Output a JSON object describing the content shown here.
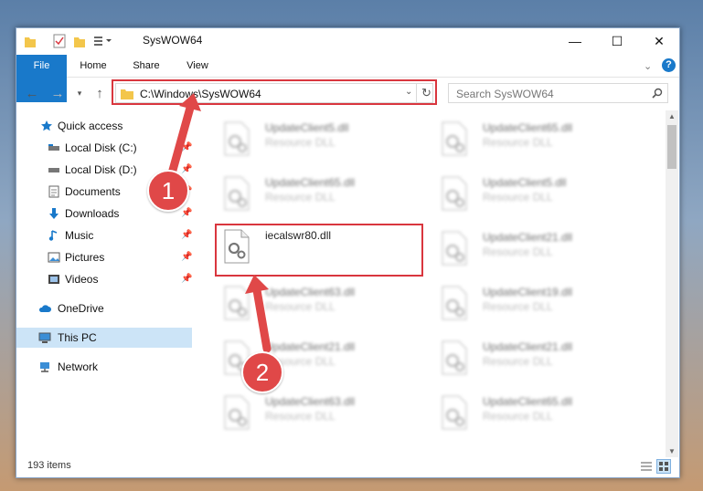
{
  "window": {
    "title": "SysWOW64",
    "controls": {
      "minimize": "—",
      "maximize": "☐",
      "close": "✕"
    }
  },
  "ribbon": {
    "tabs": [
      {
        "label": "File"
      },
      {
        "label": "Home"
      },
      {
        "label": "Share"
      },
      {
        "label": "View"
      }
    ]
  },
  "nav": {
    "address": "C:\\Windows\\SysWOW64",
    "search_placeholder": "Search SysWOW64"
  },
  "sidebar": {
    "items": [
      {
        "label": "Quick access",
        "icon": "star-icon"
      },
      {
        "label": "Local Disk (C:)",
        "icon": "drive-icon"
      },
      {
        "label": "Local Disk (D:)",
        "icon": "drive-icon"
      },
      {
        "label": "Documents",
        "icon": "document-icon"
      },
      {
        "label": "Downloads",
        "icon": "download-icon"
      },
      {
        "label": "Music",
        "icon": "music-icon"
      },
      {
        "label": "Pictures",
        "icon": "pictures-icon"
      },
      {
        "label": "Videos",
        "icon": "videos-icon"
      },
      {
        "label": "OneDrive",
        "icon": "cloud-icon"
      },
      {
        "label": "This PC",
        "icon": "computer-icon"
      },
      {
        "label": "Network",
        "icon": "network-icon"
      }
    ]
  },
  "files": [
    {
      "name": "UpdateClient5.dll",
      "type": "Resource DLL"
    },
    {
      "name": "UpdateClient65.dll",
      "type": "Resource DLL"
    },
    {
      "name": "UpdateClient65.dll",
      "type": "Resource DLL"
    },
    {
      "name": "UpdateClient5.dll",
      "type": "Resource DLL"
    },
    {
      "name": "iecalswr80.dll",
      "type": ""
    },
    {
      "name": "UpdateClient21.dll",
      "type": "Resource DLL"
    },
    {
      "name": "UpdateClient63.dll",
      "type": "Resource DLL"
    },
    {
      "name": "UpdateClient19.dll",
      "type": "Resource DLL"
    },
    {
      "name": "UpdateClient21.dll",
      "type": "Resource DLL"
    },
    {
      "name": "UpdateClient21.dll",
      "type": "Resource DLL"
    },
    {
      "name": "UpdateClient63.dll",
      "type": "Resource DLL"
    },
    {
      "name": "UpdateClient65.dll",
      "type": "Resource DLL"
    }
  ],
  "status": {
    "count": "193 items"
  },
  "annotations": {
    "step1": "1",
    "step2": "2"
  },
  "colors": {
    "accent": "#1979ca",
    "highlight": "#d9363e"
  }
}
